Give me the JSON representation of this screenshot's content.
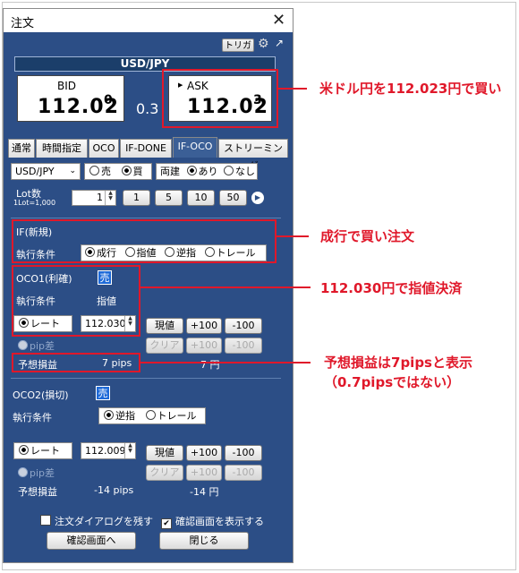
{
  "window": {
    "title": "注文"
  },
  "toolbar": {
    "trigger_label": "トリガー"
  },
  "pair_bar": "USD/JPY",
  "bid": {
    "label": "BID",
    "main": "112.02",
    "sup": "0"
  },
  "spread": "0.3",
  "ask": {
    "label": "ASK",
    "main": "112.02",
    "sup": "3"
  },
  "tabs": [
    "通常",
    "時間指定",
    "OCO",
    "IF-DONE",
    "IF-OCO",
    "ストリーミング"
  ],
  "order_row": {
    "pair": "USD/JPY",
    "sell": "売",
    "buy": "買",
    "hedge_label": "両建",
    "hedge_yes": "あり",
    "hedge_no": "なし"
  },
  "lot": {
    "label": "Lot数",
    "sub": "1Lot=1,000",
    "value": "1",
    "presets": [
      "1",
      "5",
      "10",
      "50"
    ]
  },
  "if_section": {
    "title": "IF(新規)",
    "cond_label": "執行条件",
    "options": [
      "成行",
      "指値",
      "逆指",
      "トレール"
    ]
  },
  "oco1": {
    "title": "OCO1(利確)",
    "side": "売",
    "cond_label": "執行条件",
    "cond_value": "指値",
    "rate_label": "レート",
    "rate_value": "112.030",
    "pip_label": "pip差",
    "profit_label": "予想損益",
    "profit_pips": "7 pips",
    "profit_yen": "7 円"
  },
  "oco2": {
    "title": "OCO2(損切)",
    "side": "売",
    "cond_label": "執行条件",
    "opt1": "逆指",
    "opt2": "トレール",
    "rate_label": "レート",
    "rate_value": "112.009",
    "pip_label": "pip差",
    "profit_label": "予想損益",
    "profit_pips": "-14 pips",
    "profit_yen": "-14 円"
  },
  "adjust": {
    "current": "現値",
    "plus": "+100",
    "minus": "-100",
    "clear": "クリア"
  },
  "footer": {
    "keep_dialog": "注文ダイアログを残す",
    "show_confirm": "確認画面を表示する",
    "confirm_btn": "確認画面へ",
    "close_btn": "閉じる"
  },
  "annotations": {
    "a1": "米ドル円を112.023円で買い",
    "a2": "成行で買い注文",
    "a3": "112.030円で指値決済",
    "a4a": "予想損益は7pipsと表示",
    "a4b": "（0.7pipsではない）"
  },
  "colors": {
    "panel": "#2c4e86",
    "highlight": "#e0182a",
    "badge": "#1e6ad8"
  }
}
